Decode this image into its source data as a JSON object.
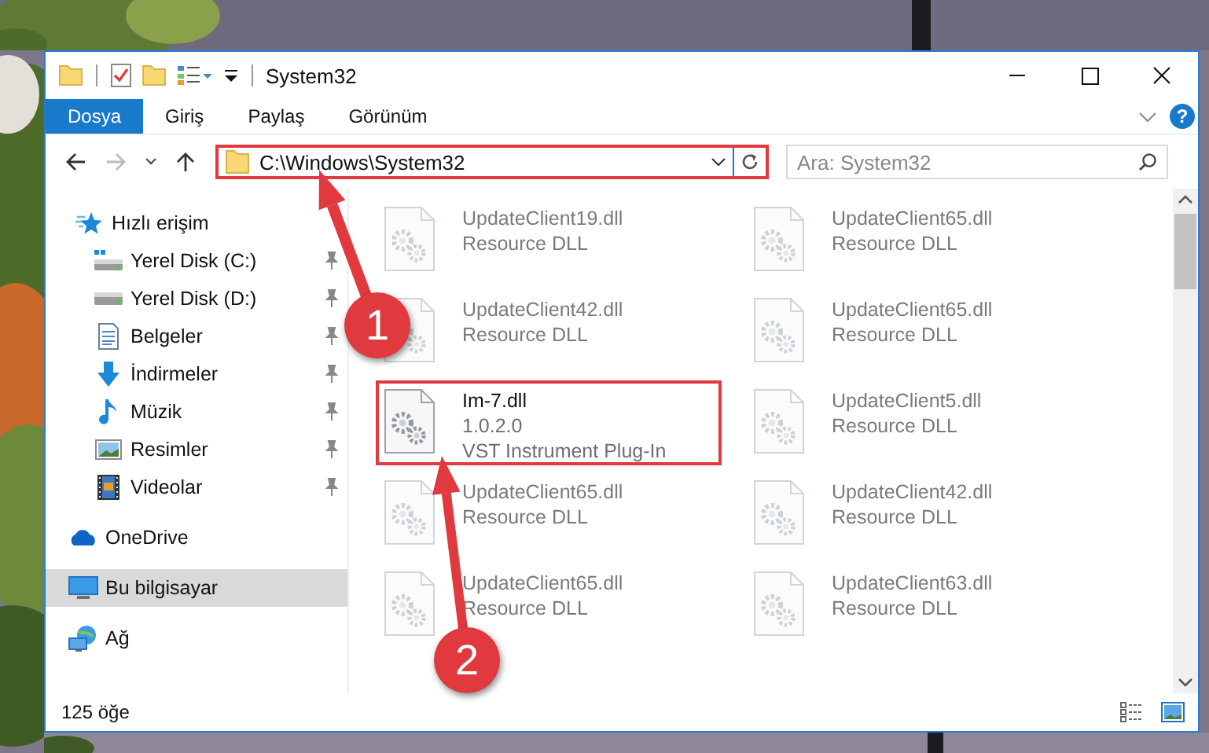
{
  "window": {
    "title": "System32",
    "controls": [
      {
        "kind": "minimize"
      },
      {
        "kind": "maximize"
      },
      {
        "kind": "close"
      }
    ]
  },
  "ribbon": {
    "tabs": [
      {
        "label": "Dosya",
        "selected": true
      },
      {
        "label": "Giriş",
        "selected": false
      },
      {
        "label": "Paylaş",
        "selected": false
      },
      {
        "label": "Görünüm",
        "selected": false
      }
    ],
    "help": "?"
  },
  "navigation": {
    "buttons": [
      {
        "kind": "back",
        "disabled": false
      },
      {
        "kind": "forward",
        "disabled": true
      },
      {
        "kind": "recent",
        "disabled": false
      },
      {
        "kind": "up",
        "disabled": false
      }
    ],
    "address": {
      "text": "C:\\Windows\\System32",
      "highlighted": true
    },
    "search": {
      "placeholder": "Ara: System32"
    }
  },
  "sidebar": {
    "items": [
      {
        "label": "Hızlı erişim",
        "kind": "star",
        "selected": false,
        "children": [
          {
            "label": "Yerel Disk (C:)",
            "kind": "system-drive",
            "selected": false,
            "pinned": true
          },
          {
            "label": "Yerel Disk (D:)",
            "kind": "drive",
            "selected": false,
            "pinned": true
          },
          {
            "label": "Belgeler",
            "kind": "documents",
            "selected": false,
            "pinned": true
          },
          {
            "label": "İndirmeler",
            "kind": "downloads",
            "selected": false,
            "pinned": true
          },
          {
            "label": "Müzik",
            "kind": "music",
            "selected": false,
            "pinned": true
          },
          {
            "label": "Resimler",
            "kind": "pictures",
            "selected": false,
            "pinned": true
          },
          {
            "label": "Videolar",
            "kind": "videos",
            "selected": false,
            "pinned": true
          }
        ]
      },
      {
        "label": "OneDrive",
        "kind": "cloud",
        "selected": false
      },
      {
        "label": "Bu bilgisayar",
        "kind": "computer",
        "selected": true
      },
      {
        "label": "Ağ",
        "kind": "network",
        "selected": false
      }
    ]
  },
  "files": [
    {
      "name": "UpdateClient19.dll",
      "details": [
        "Resource DLL"
      ],
      "dimmed": true,
      "highlighted": false
    },
    {
      "name": "UpdateClient65.dll",
      "details": [
        "Resource DLL"
      ],
      "dimmed": true,
      "highlighted": false
    },
    {
      "name": "UpdateClient42.dll",
      "details": [
        "Resource DLL"
      ],
      "dimmed": true,
      "highlighted": false
    },
    {
      "name": "UpdateClient65.dll",
      "details": [
        "Resource DLL"
      ],
      "dimmed": true,
      "highlighted": false
    },
    {
      "name": "Im-7.dll",
      "details": [
        "1.0.2.0",
        "VST Instrument Plug-In"
      ],
      "dimmed": false,
      "highlighted": true
    },
    {
      "name": "UpdateClient5.dll",
      "details": [
        "Resource DLL"
      ],
      "dimmed": true,
      "highlighted": false
    },
    {
      "name": "UpdateClient65.dll",
      "details": [
        "Resource DLL"
      ],
      "dimmed": true,
      "highlighted": false
    },
    {
      "name": "UpdateClient42.dll",
      "details": [
        "Resource DLL"
      ],
      "dimmed": true,
      "highlighted": false
    },
    {
      "name": "UpdateClient65.dll",
      "details": [
        "Resource DLL"
      ],
      "dimmed": true,
      "highlighted": false
    },
    {
      "name": "UpdateClient63.dll",
      "details": [
        "Resource DLL"
      ],
      "dimmed": true,
      "highlighted": false
    }
  ],
  "status_bar": {
    "count": "125 öğe"
  },
  "steps": [
    {
      "label": "1"
    },
    {
      "label": "2"
    }
  ]
}
